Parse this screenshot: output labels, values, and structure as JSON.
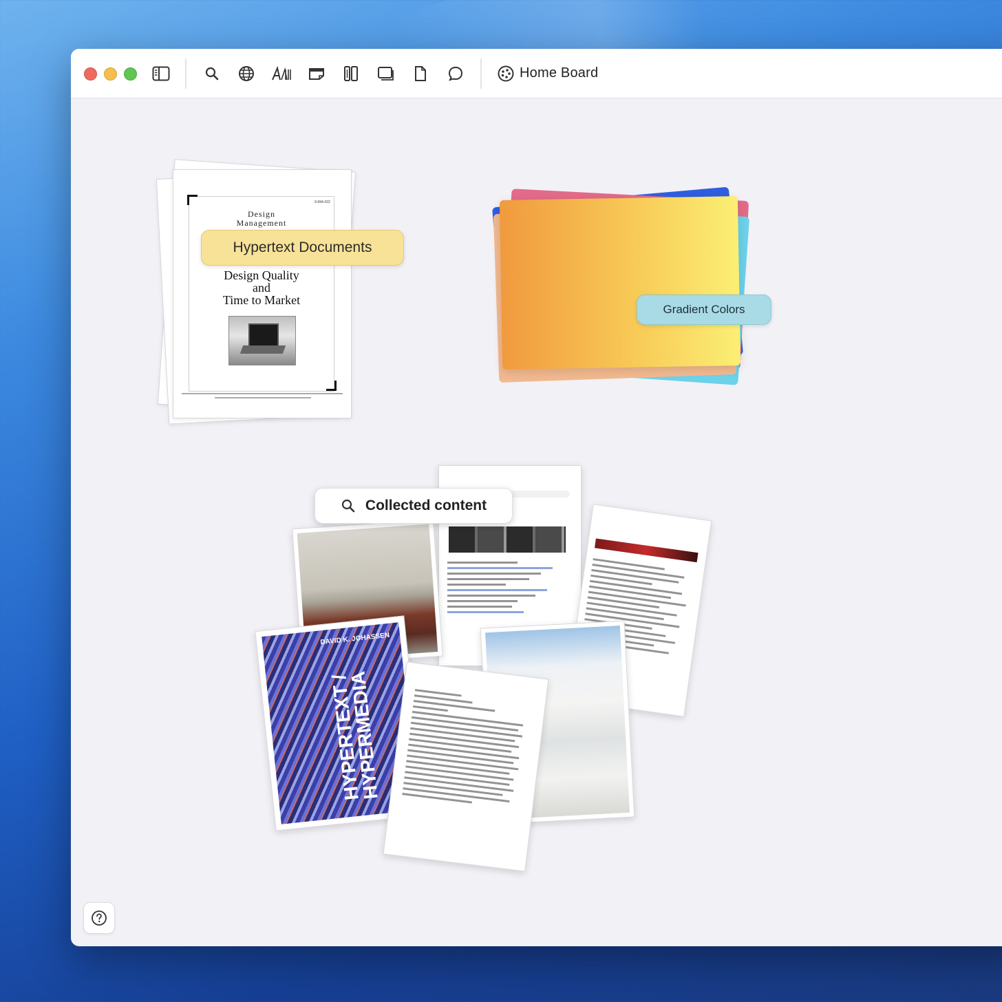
{
  "window": {
    "board_title": "Home Board"
  },
  "toolbar": {
    "icons": [
      "sidebar-icon",
      "search-icon",
      "globe-icon",
      "text-icon",
      "note-icon",
      "books-icon",
      "card-icon",
      "document-icon",
      "comment-icon"
    ],
    "board_icon": "board-icon"
  },
  "board": {
    "stacks": [
      {
        "label": "Hypertext Documents",
        "color": "#f7e297"
      },
      {
        "label": "Gradient Colors",
        "color": "#a9dbe6"
      },
      {
        "label": "Collected content",
        "color": "#ffffff"
      }
    ]
  },
  "document_preview": {
    "heading": [
      "Design",
      "Management"
    ],
    "body_lines": [
      "Design Quality",
      "and",
      "Time to Market"
    ]
  },
  "collage": {
    "book_author": "DAVID K. JOHASSEN",
    "book_title": "HYPERTEXT / HYPERMEDIA"
  },
  "colors": {
    "gradient_card": [
      "#f09a3e",
      "#fbe772"
    ],
    "card_blue": "#2f5fe0",
    "card_pink": "#e36b8a",
    "card_cyan": "#6cd1ea",
    "card_peach": "#f2b98f"
  },
  "help_icon": "help-icon"
}
